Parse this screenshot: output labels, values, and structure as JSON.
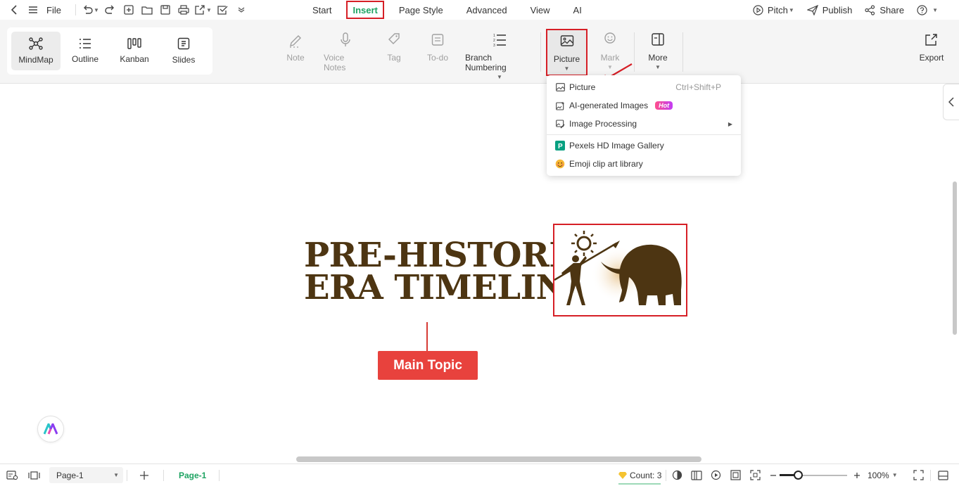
{
  "menubar": {
    "file_label": "File",
    "tabs": [
      {
        "label": "Start"
      },
      {
        "label": "Insert"
      },
      {
        "label": "Page Style"
      },
      {
        "label": "Advanced"
      },
      {
        "label": "View"
      },
      {
        "label": "AI"
      }
    ],
    "pitch_label": "Pitch",
    "publish_label": "Publish",
    "share_label": "Share"
  },
  "views": [
    {
      "label": "MindMap"
    },
    {
      "label": "Outline"
    },
    {
      "label": "Kanban"
    },
    {
      "label": "Slides"
    }
  ],
  "tools": {
    "note": "Note",
    "voice_notes": "Voice Notes",
    "tag": "Tag",
    "todo": "To-do",
    "branch_numbering": "Branch Numbering",
    "picture": "Picture",
    "mark": "Mark",
    "more": "More",
    "export": "Export"
  },
  "picture_menu": {
    "items": [
      {
        "label": "Picture",
        "shortcut": "Ctrl+Shift+P"
      },
      {
        "label": "AI-generated Images",
        "badge": "Hot"
      },
      {
        "label": "Image Processing"
      },
      {
        "label": "Pexels HD Image Gallery"
      },
      {
        "label": "Emoji clip art library"
      }
    ]
  },
  "canvas": {
    "title_line1": "PRE-HISTORIC",
    "title_line2": "ERA TIMELINE",
    "main_topic": "Main Topic"
  },
  "statusbar": {
    "page_select": "Page-1",
    "page_tab": "Page-1",
    "count_label": "Count: 3",
    "zoom_label": "100%",
    "zoom_fraction": 0.28
  },
  "colors": {
    "accent_green": "#1ea362",
    "highlight_red": "#d61f26",
    "topic_red": "#e8423d",
    "title_brown": "#4d3512"
  }
}
